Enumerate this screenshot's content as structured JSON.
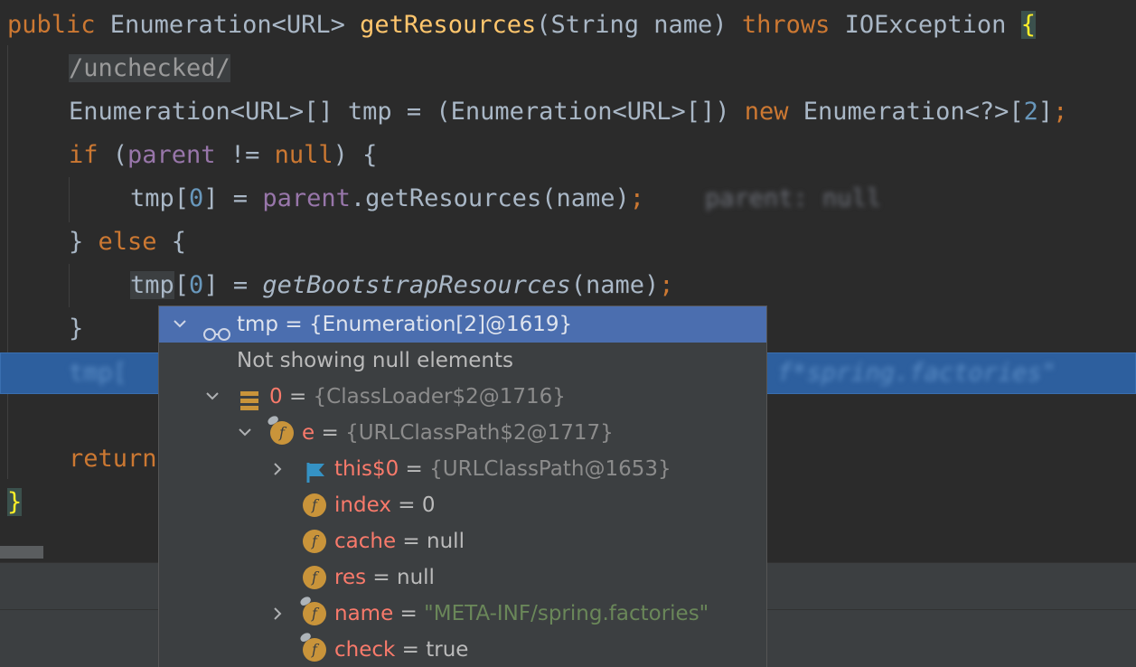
{
  "code": {
    "line1": {
      "kw_public": "public",
      "type": " Enumeration<URL> ",
      "method": "getResources",
      "params": "(String name) ",
      "kw_throws": "throws",
      "exc": " IOException ",
      "brace": "{"
    },
    "line2": {
      "text": "/unchecked/"
    },
    "line3": {
      "p1": "Enumeration<URL>[] tmp = (Enumeration<URL>[]) ",
      "kw_new": "new",
      "p2": " Enumeration<?>[",
      "num": "2",
      "p3": "]",
      "semi": ";"
    },
    "line4": {
      "kw_if": "if",
      "p1": " (",
      "field": "parent",
      "p2": " != ",
      "kw_null": "null",
      "p3": ") {"
    },
    "line5": {
      "p1": "tmp[",
      "num": "0",
      "p2": "] = ",
      "field": "parent",
      "p3": ".getResources(name)",
      "semi": ";",
      "hint": "parent: null"
    },
    "line6": {
      "p1": "} ",
      "kw_else": "else",
      "p2": " {"
    },
    "line7": {
      "tmp": "tmp",
      "p1": "[",
      "num": "0",
      "p2": "] = ",
      "method": "getBootstrapResources",
      "p3": "(name)",
      "semi": ";"
    },
    "line8": {
      "text": "}"
    },
    "exec": {
      "left": "tmp[",
      "right": "f*spring.factories\""
    },
    "line10": {
      "kw_return": "return"
    },
    "line11": {
      "brace": "}"
    }
  },
  "popup": {
    "header": {
      "name": "tmp",
      "eq": " = ",
      "value": "{Enumeration[2]@1619}"
    },
    "notice": "Not showing null elements",
    "rows": [
      {
        "name": "0",
        "eq": " = ",
        "value": "{ClassLoader$2@1716}"
      },
      {
        "name": "e",
        "eq": " = ",
        "value": "{URLClassPath$2@1717}"
      },
      {
        "name": "this$0",
        "eq": " = ",
        "value": "{URLClassPath@1653}"
      },
      {
        "name": "index",
        "eq": " = ",
        "value": "0"
      },
      {
        "name": "cache",
        "eq": " = ",
        "value": "null"
      },
      {
        "name": "res",
        "eq": " = ",
        "value": "null"
      },
      {
        "name": "name",
        "eq": " = ",
        "value": "\"META-INF/spring.factories\""
      },
      {
        "name": "check",
        "eq": " = ",
        "value": "true"
      }
    ],
    "field_icon_letter": "f"
  },
  "colors": {
    "background": "#2b2b2b",
    "keyword": "#cc7832",
    "method": "#ffc66d",
    "field": "#9876aa",
    "number": "#6897bb",
    "exec_line": "#2d5f9e",
    "popup_bg": "#3c3f41",
    "popup_selected": "#4b6eaf",
    "var_name": "#f97a6b",
    "string": "#6a8759"
  }
}
